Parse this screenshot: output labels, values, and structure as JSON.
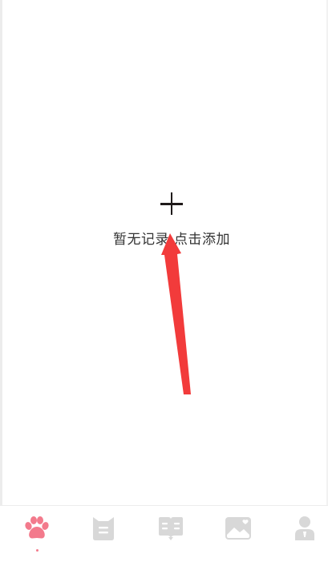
{
  "empty_state": {
    "icon": "plus-icon",
    "message": "暂无记录,点击添加"
  },
  "tabbar": {
    "active_color": "#f37a8c",
    "inactive_color": "#d8d8d8",
    "tabs": [
      {
        "icon": "paw-icon",
        "active": true
      },
      {
        "icon": "cat-face-icon",
        "active": false
      },
      {
        "icon": "book-icon",
        "active": false
      },
      {
        "icon": "photo-icon",
        "active": false
      },
      {
        "icon": "user-icon",
        "active": false
      }
    ]
  },
  "annotation": {
    "color": "#f23b3b"
  }
}
